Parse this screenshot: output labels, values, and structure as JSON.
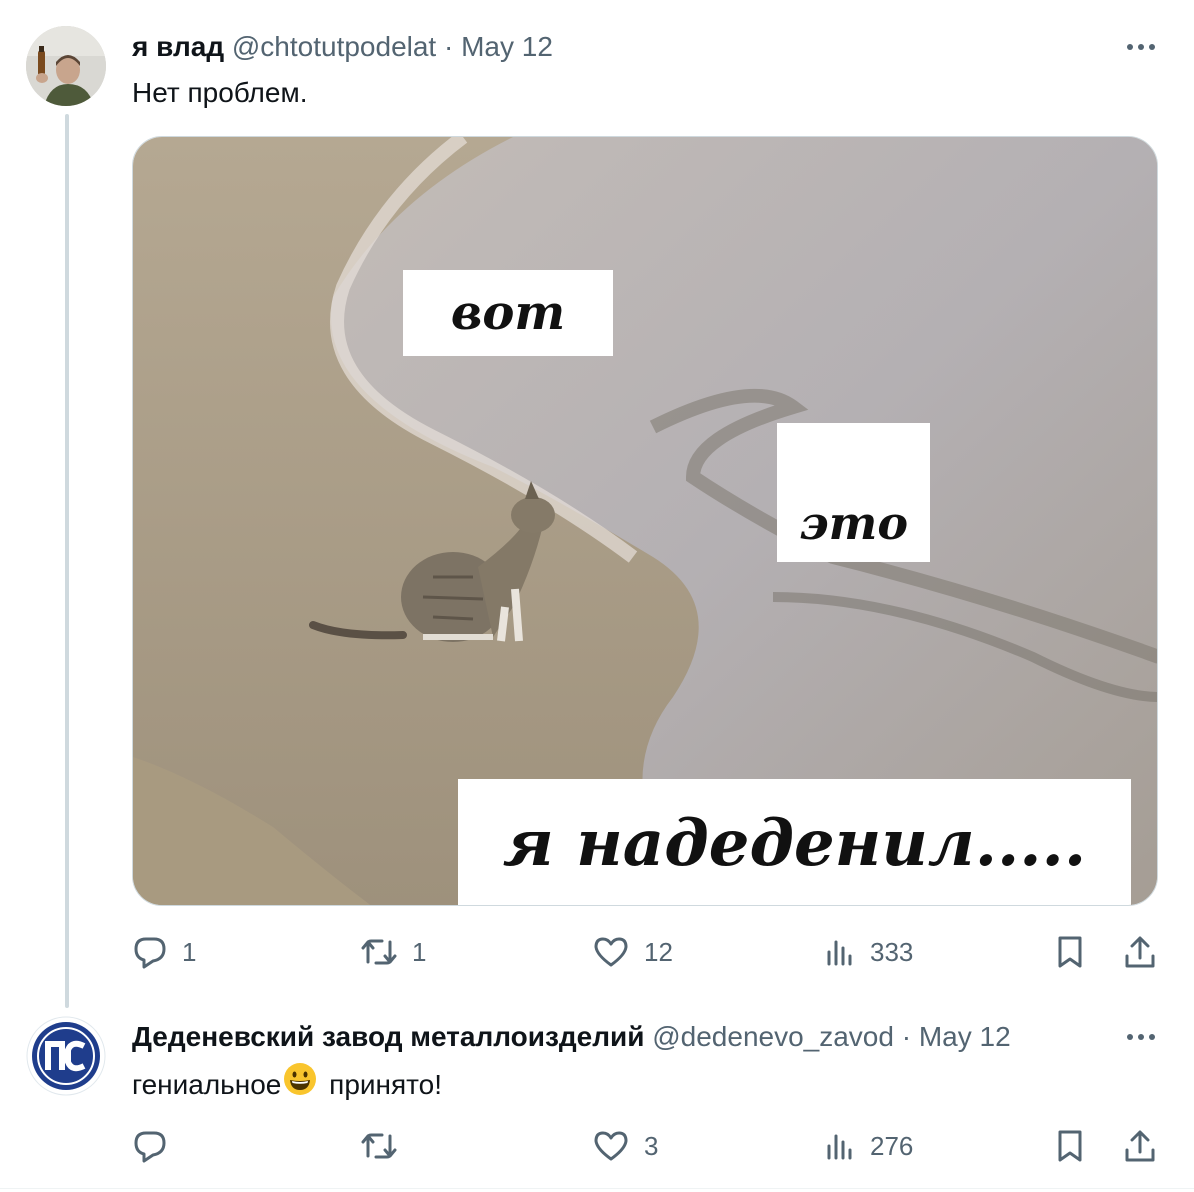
{
  "tweets": [
    {
      "author_name": "я влад",
      "handle": "@chtotutpodelat",
      "separator": "·",
      "date": "May 12",
      "text": "Нет проблем.",
      "media": {
        "captions": [
          "вот",
          "это",
          "я надеденил....."
        ]
      },
      "replies": "1",
      "retweets": "1",
      "likes": "12",
      "views": "333",
      "icons": [
        "more-icon",
        "reply-icon",
        "retweet-icon",
        "like-icon",
        "views-icon",
        "bookmark-icon",
        "share-icon"
      ]
    },
    {
      "author_name": "Деденевский завод металлоизделий",
      "handle": "@dedenevo_zavod",
      "separator": "·",
      "date": "May 12",
      "text_before": "гениальное",
      "emoji": "grinning-face-emoji",
      "text_after": " принято!",
      "replies": "",
      "retweets": "",
      "likes": "3",
      "views": "276"
    }
  ],
  "colors": {
    "text": "#0f1419",
    "secondary": "#536471",
    "divider": "#cfd9de",
    "logo_blue": "#1f3d8c"
  }
}
